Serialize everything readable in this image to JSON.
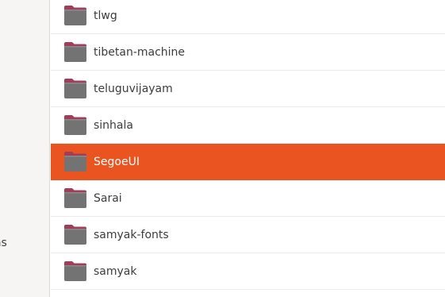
{
  "sidebar": {
    "partial_item_label": "ons"
  },
  "files": [
    {
      "name": "tlwg",
      "selected": false,
      "icon": "folder-icon"
    },
    {
      "name": "tibetan-machine",
      "selected": false,
      "icon": "folder-icon"
    },
    {
      "name": "teluguvijayam",
      "selected": false,
      "icon": "folder-icon"
    },
    {
      "name": "sinhala",
      "selected": false,
      "icon": "folder-icon"
    },
    {
      "name": "SegoeUI",
      "selected": true,
      "icon": "folder-icon"
    },
    {
      "name": "Sarai",
      "selected": false,
      "icon": "folder-icon"
    },
    {
      "name": "samyak-fonts",
      "selected": false,
      "icon": "folder-icon"
    },
    {
      "name": "samyak",
      "selected": false,
      "icon": "folder-icon"
    }
  ],
  "colors": {
    "selection": "#e95420",
    "folder_body": "#737373",
    "folder_tab": "#a23c58",
    "text": "#3d3d3d",
    "selected_text": "#ffffff"
  }
}
